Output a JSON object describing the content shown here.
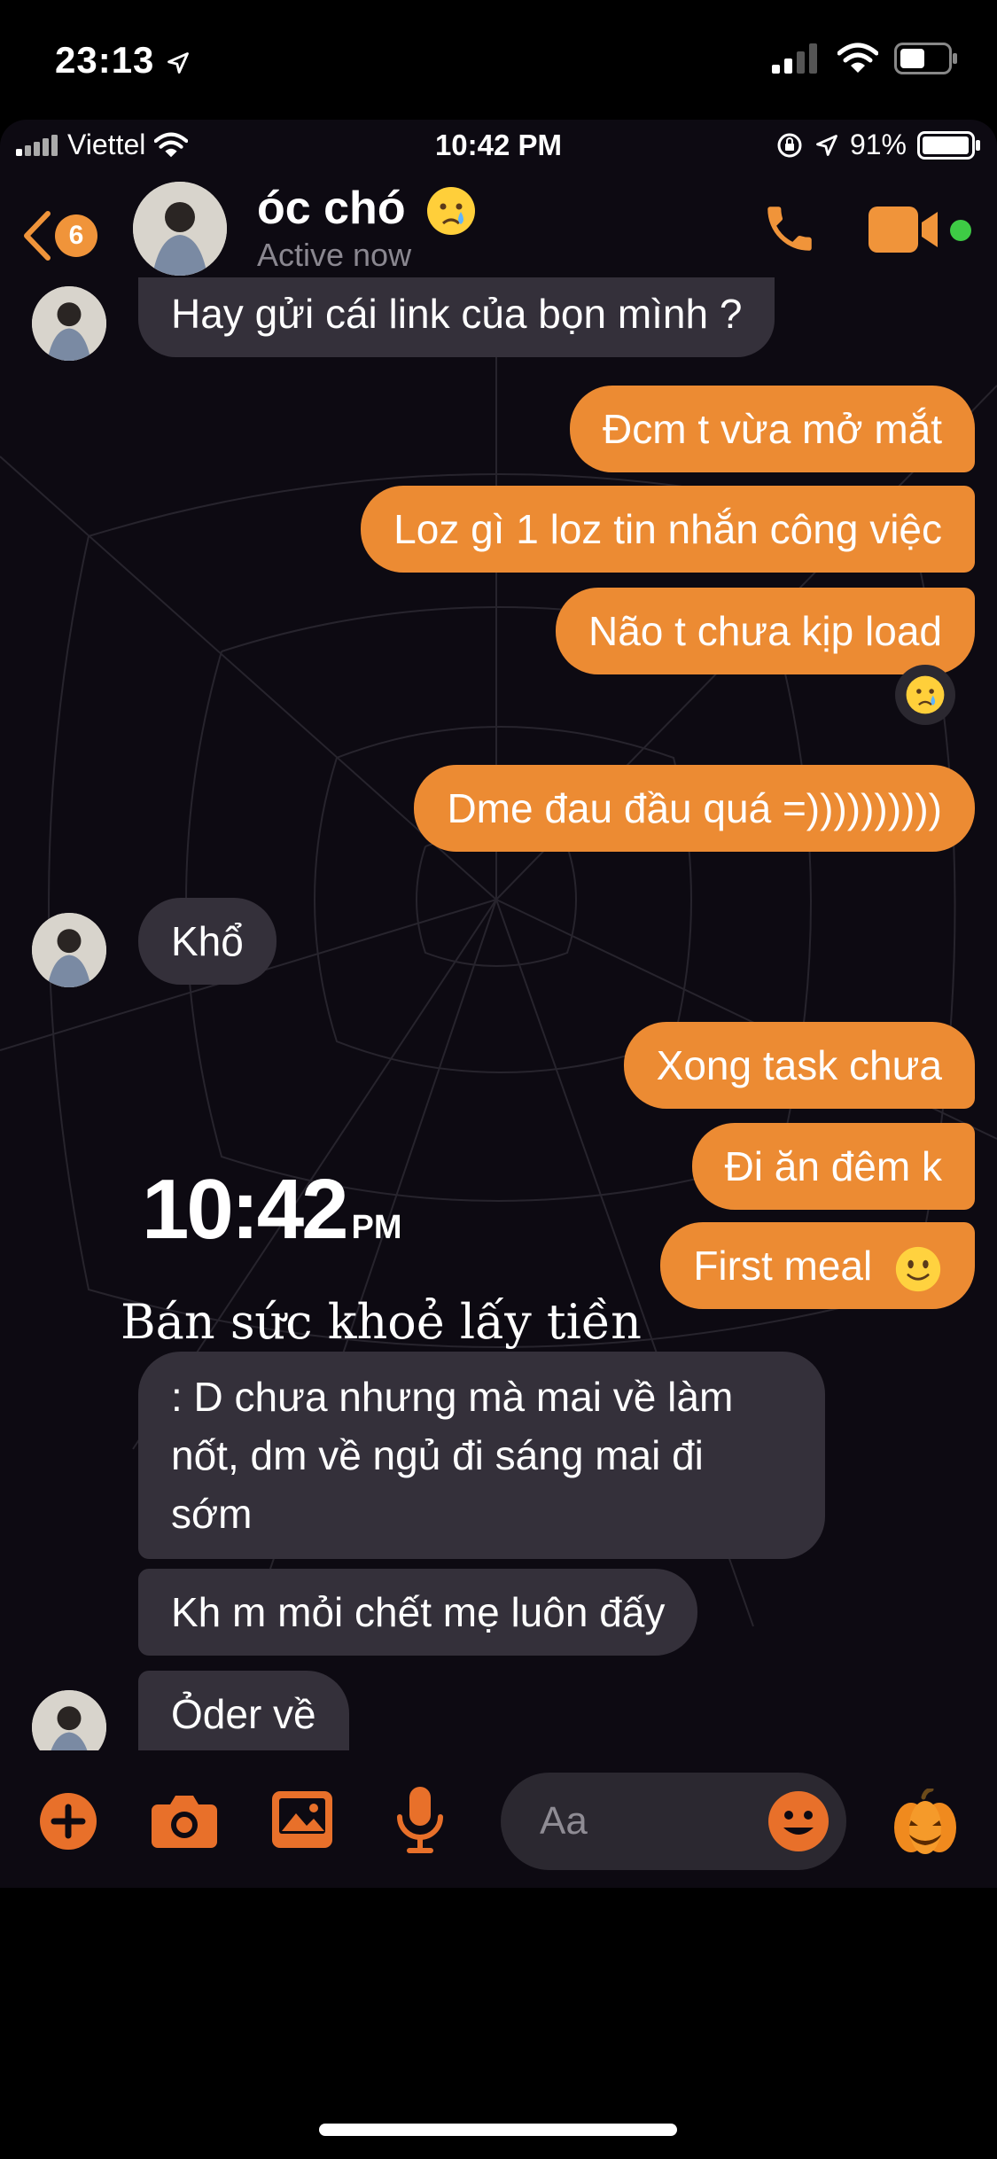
{
  "outer_status": {
    "time": "23:13"
  },
  "inner_status": {
    "carrier": "Viettel",
    "time": "10:42 PM",
    "battery": "91%"
  },
  "header": {
    "back_count": "6",
    "contact_name": "óc chó",
    "status": "Active now"
  },
  "messages": [
    {
      "from": "them",
      "text": "Hay gửi cái link của bọn mình ?"
    },
    {
      "from": "me",
      "text": "Đcm t vừa mở mắt"
    },
    {
      "from": "me",
      "text": "Loz gì 1 loz tin nhắn công việc"
    },
    {
      "from": "me",
      "text": "Não t chưa kịp load"
    },
    {
      "from": "me",
      "text": "Dme đau đầu quá =))))))))))"
    },
    {
      "from": "them",
      "text": "Khổ"
    },
    {
      "from": "me",
      "text": "Xong task chưa"
    },
    {
      "from": "me",
      "text": "Đi ăn đêm k"
    },
    {
      "from": "me",
      "text": "First meal"
    },
    {
      "from": "them",
      "lines": [
        ": D chưa nhưng mà mai về làm",
        "nốt, dm về ngủ đi sáng mai đi",
        "sớm"
      ]
    },
    {
      "from": "them",
      "text": "Kh m mỏi chết mẹ luôn đấy"
    },
    {
      "from": "them",
      "text": "Ỏder về"
    }
  ],
  "sticker": {
    "time": "10:42",
    "ampm": "PM",
    "caption": "Bán sức khoẻ lấy tiền"
  },
  "composer": {
    "placeholder": "Aa"
  },
  "colors": {
    "accent": "#ec8b33",
    "incoming_bubble": "#34303a",
    "background": "#0d0a12"
  },
  "icons": [
    "back-chevron-icon",
    "phone-icon",
    "video-icon",
    "plus-icon",
    "camera-icon",
    "image-icon",
    "mic-icon",
    "emoji-icon",
    "pumpkin-icon",
    "crying-emoji-icon",
    "smile-emoji-icon"
  ]
}
